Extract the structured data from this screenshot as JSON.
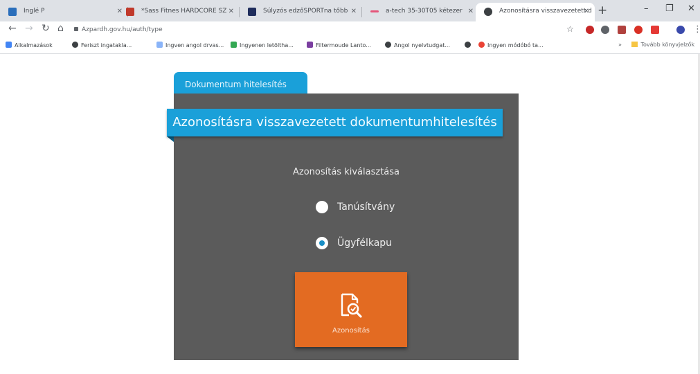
{
  "browser": {
    "tabs": [
      {
        "title": "Inglé P",
        "color": "#2a6ebb"
      },
      {
        "title": "*Sass Fitnes HARDCORE SZ",
        "color": "#c0392b"
      },
      {
        "title": "Súlyzós edzőSPORTna tőbb",
        "color": "#1f2d5c"
      },
      {
        "title": "a-tech 35-30T05 kétezer",
        "color": "#e5567b"
      },
      {
        "title": "Azonosításra visszavezetett d",
        "color": "#3c4043"
      }
    ],
    "url": "Azpardh.gov.hu/auth/type",
    "bookmarks": [
      {
        "label": "Alkalmazások",
        "color": "#4285f4"
      },
      {
        "label": "Feriszt ingatakla...",
        "color": "#3c4043"
      },
      {
        "label": "Ingven angol drvas...",
        "color": "#8ab4f8"
      },
      {
        "label": "Ingyenen letöltha...",
        "color": "#34a853"
      },
      {
        "label": "Filtermoude Lanto...",
        "color": "#7b3fa0"
      },
      {
        "label": "Angol nyelvtudgat...",
        "color": "#3c4043"
      },
      {
        "label": "",
        "color": "#3c4043"
      },
      {
        "label": "Ingyen módóbó ta...",
        "color": "#ea4335"
      }
    ],
    "more_bookmarks": "Tovább könyvjelzők"
  },
  "page": {
    "tab_label": "Dokumentum hitelesítés",
    "title": "Azonosításra visszavezetett dokumentumhitelesítés",
    "section_label": "Azonosítás kiválasztása",
    "options": [
      {
        "label": "Tanúsítvány",
        "checked": false
      },
      {
        "label": "Ügyfélkapu",
        "checked": true
      }
    ],
    "button_label": "Azonosítás",
    "button_icon": "document-search-icon",
    "colors": {
      "accent": "#1aa0d9",
      "button": "#e36b22",
      "panel": "#5b5b5b"
    }
  }
}
